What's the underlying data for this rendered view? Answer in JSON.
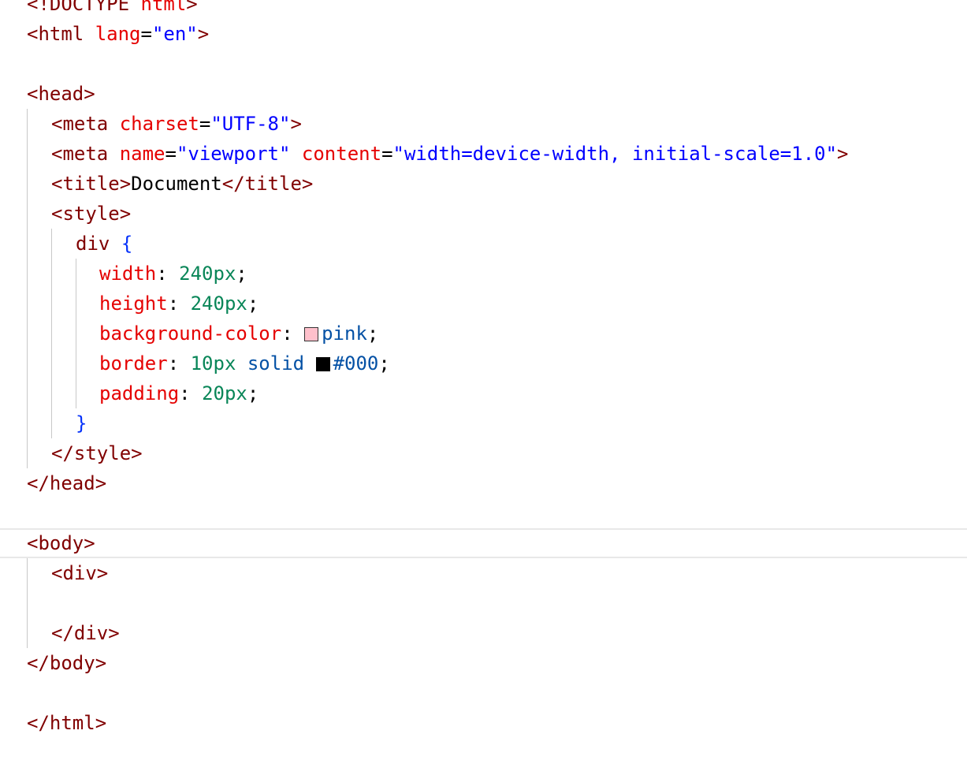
{
  "code": {
    "doctype": "<!DOCTYPE",
    "doctype_kw": "html",
    "doctype_end": ">",
    "html_open": "<html",
    "lang_attr": "lang",
    "lang_val": "\"en\"",
    "html_open_end": ">",
    "head_open": "<head>",
    "meta1_open": "<meta",
    "charset_attr": "charset",
    "charset_val": "\"UTF-8\"",
    "meta1_end": ">",
    "meta2_open": "<meta",
    "name_attr": "name",
    "name_val": "\"viewport\"",
    "content_attr": "content",
    "content_val": "\"width=device-width, initial-scale=1.0\"",
    "meta2_end": ">",
    "title_open": "<title>",
    "title_text": "Document",
    "title_close": "</title>",
    "style_open": "<style>",
    "selector": "div",
    "brace_open": "{",
    "props": [
      {
        "name": "width",
        "value": "240px",
        "suffix": ";"
      },
      {
        "name": "height",
        "value": "240px",
        "suffix": ";"
      },
      {
        "name": "background-color",
        "value": "pink",
        "suffix": ";"
      },
      {
        "name": "border",
        "value1": "10px",
        "value2": "solid",
        "value3": "#000",
        "suffix": ";"
      },
      {
        "name": "padding",
        "value": "20px",
        "suffix": ";"
      }
    ],
    "brace_close": "}",
    "style_close": "</style>",
    "head_close": "</head>",
    "body_open": "<body>",
    "div_open": "<div>",
    "div_close": "</div>",
    "body_close": "</body>",
    "html_close": "</html>"
  },
  "colors": {
    "pink_swatch": "#ffc0cb",
    "black_swatch": "#000000"
  }
}
